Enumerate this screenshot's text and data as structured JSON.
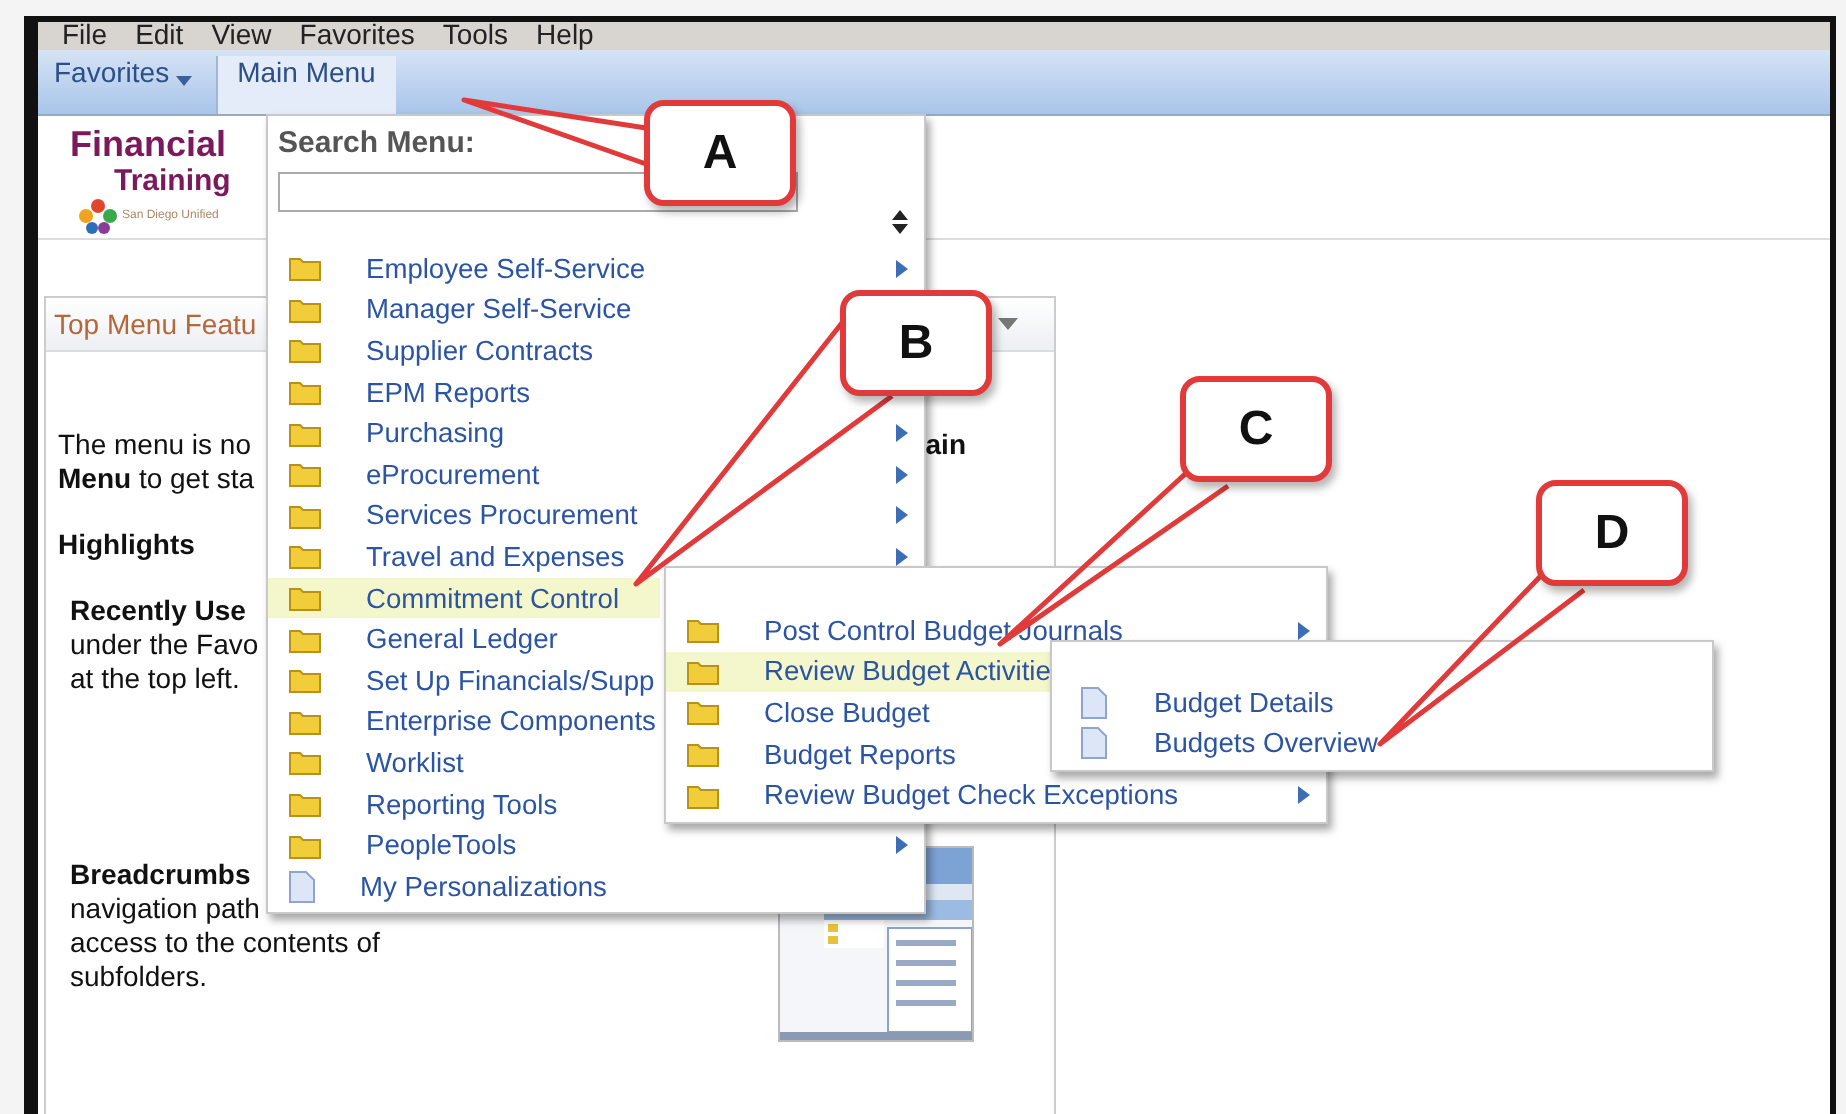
{
  "menubar": [
    "File",
    "Edit",
    "View",
    "Favorites",
    "Tools",
    "Help"
  ],
  "nav_tabs": [
    {
      "label": "Favorites",
      "selected": false,
      "caret": true
    },
    {
      "label": "Main Menu",
      "selected": true,
      "caret": false
    }
  ],
  "branding": {
    "title": "Financial",
    "subtitle": "Training",
    "district": "San Diego Unified"
  },
  "pagelet": {
    "title": "Top Menu Featu",
    "intro": [
      "The menu is no",
      "**Menu** to get sta"
    ],
    "intro_right": "ain",
    "highlights": "Highlights",
    "recently_used": {
      "heading": "Recently Use",
      "lines": [
        "under the Favo",
        "at the top left."
      ]
    },
    "breadcrumbs": {
      "heading": "Breadcrumbs",
      "lines": [
        "navigation path",
        "access to the contents of",
        "subfolders."
      ]
    },
    "thumbnail": {
      "kind": "picture"
    }
  },
  "main_menu": {
    "search_label": "Search Menu:",
    "items": [
      {
        "label": "Employee Self-Service",
        "kind": "folder",
        "arrow": true,
        "selected": false
      },
      {
        "label": "Manager Self-Service",
        "kind": "folder",
        "arrow": false,
        "selected": false
      },
      {
        "label": "Supplier Contracts",
        "kind": "folder",
        "arrow": false,
        "selected": false
      },
      {
        "label": "EPM Reports",
        "kind": "folder",
        "arrow": false,
        "selected": false
      },
      {
        "label": "Purchasing",
        "kind": "folder",
        "arrow": true,
        "selected": false
      },
      {
        "label": "eProcurement",
        "kind": "folder",
        "arrow": true,
        "selected": false
      },
      {
        "label": "Services Procurement",
        "kind": "folder",
        "arrow": true,
        "selected": false
      },
      {
        "label": "Travel and Expenses",
        "kind": "folder",
        "arrow": true,
        "selected": false
      },
      {
        "label": "Commitment Control",
        "kind": "folder",
        "arrow": false,
        "selected": true
      },
      {
        "label": "General Ledger",
        "kind": "folder",
        "arrow": false,
        "selected": false
      },
      {
        "label": "Set Up Financials/Supp",
        "kind": "folder",
        "arrow": false,
        "selected": false
      },
      {
        "label": "Enterprise Components",
        "kind": "folder",
        "arrow": false,
        "selected": false
      },
      {
        "label": "Worklist",
        "kind": "folder",
        "arrow": false,
        "selected": false
      },
      {
        "label": "Reporting Tools",
        "kind": "folder",
        "arrow": false,
        "selected": false
      },
      {
        "label": "PeopleTools",
        "kind": "folder",
        "arrow": true,
        "selected": false
      },
      {
        "label": "My Personalizations",
        "kind": "page",
        "arrow": false,
        "selected": false
      }
    ]
  },
  "submenu": {
    "items": [
      {
        "label": "Post Control Budget Journals",
        "kind": "folder",
        "arrow": true,
        "selected": false
      },
      {
        "label": "Review Budget Activitie",
        "kind": "folder",
        "arrow": false,
        "selected": true
      },
      {
        "label": "Close Budget",
        "kind": "folder",
        "arrow": false,
        "selected": false
      },
      {
        "label": "Budget Reports",
        "kind": "folder",
        "arrow": false,
        "selected": false
      },
      {
        "label": "Review Budget Check Exceptions",
        "kind": "folder",
        "arrow": true,
        "selected": false
      }
    ]
  },
  "submenu_2": {
    "items": [
      {
        "label": "Budget Details",
        "kind": "page",
        "arrow": false,
        "selected": false
      },
      {
        "label": "Budgets Overview",
        "kind": "page",
        "arrow": false,
        "selected": false
      }
    ]
  },
  "callouts": [
    {
      "label": "A"
    },
    {
      "label": "B"
    },
    {
      "label": "C"
    },
    {
      "label": "D"
    }
  ]
}
